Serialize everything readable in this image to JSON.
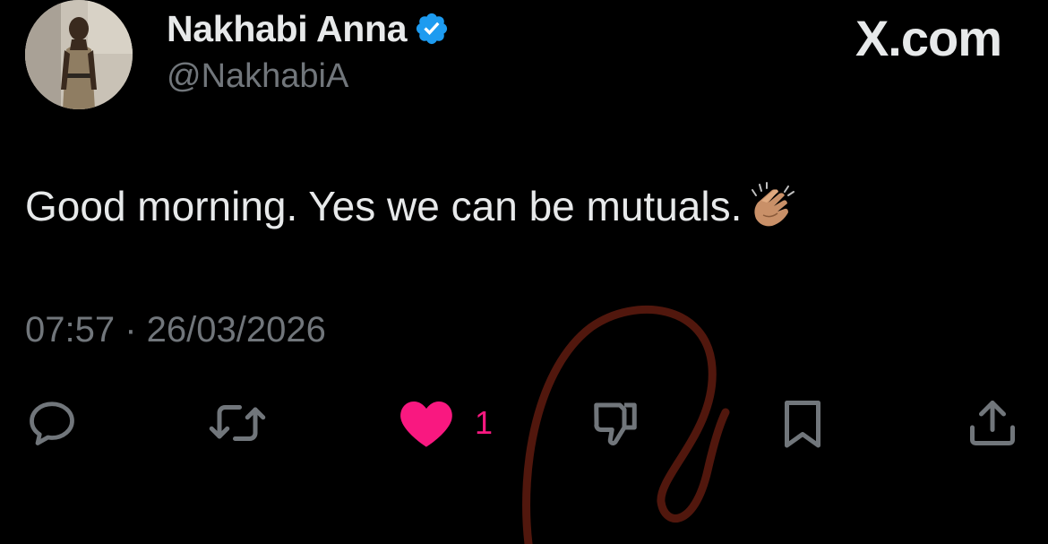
{
  "author": {
    "display_name": "Nakhabi Anna",
    "handle": "@NakhabiA",
    "verified": true,
    "verified_color": "#1d9bf0"
  },
  "brand": {
    "label": "X.com"
  },
  "tweet": {
    "text": "Good morning. Yes we can be mutuals.",
    "emoji": "clapping-hands-medium-skin-tone",
    "timestamp": "07:57 · 26/03/2026"
  },
  "actions": {
    "reply_icon": "reply-icon",
    "retweet_icon": "retweet-icon",
    "like_icon": "heart-filled-icon",
    "like_count": "1",
    "like_color": "#f91880",
    "dislike_icon": "thumbs-down-icon",
    "bookmark_icon": "bookmark-icon",
    "share_icon": "share-icon",
    "icon_color": "#71767b"
  },
  "colors": {
    "background": "#000000",
    "primary_text": "#e7e9ea",
    "secondary_text": "#71767b",
    "annotation": "#5a1a0e"
  }
}
